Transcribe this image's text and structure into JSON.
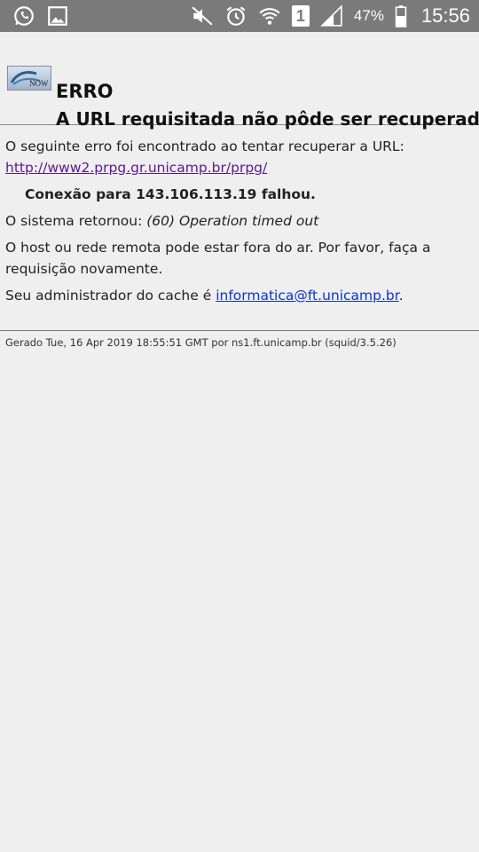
{
  "statusbar": {
    "left_icons": [
      "whatsapp-icon",
      "image-icon"
    ],
    "right_icons": [
      "mute-icon",
      "alarm-icon",
      "wifi-icon",
      "sim1-icon",
      "signal-icon",
      "battery-icon"
    ],
    "sim_label": "1",
    "battery_pct": "47%",
    "clock": "15:56"
  },
  "header": {
    "code": "ERRO",
    "title": "A URL requisitada não pôde ser recuperada",
    "logo_text": "NOW"
  },
  "body": {
    "intro": "O seguinte erro foi encontrado ao tentar recuperar a URL:",
    "url": "http://www2.prpg.gr.unicamp.br/prpg/",
    "connection_failed": "Conexão para 143.106.113.19 falhou.",
    "system_returned_label": "O sistema retornou:",
    "system_returned_value": "(60) Operation timed out",
    "host_down": "O host ou rede remota pode estar fora do ar. Por favor, faça a requisição novamente.",
    "admin_label": "Seu administrador do cache é",
    "admin_email": "informatica@ft.unicamp.br",
    "admin_suffix": "."
  },
  "footer": {
    "generated": "Gerado Tue, 16 Apr 2019 18:55:51 GMT por ns1.ft.unicamp.br (squid/3.5.26)"
  },
  "colors": {
    "statusbar_bg": "#7a7a7a",
    "page_bg": "#efefef",
    "visited_link": "#5b1a8a",
    "link": "#0b35c8"
  }
}
